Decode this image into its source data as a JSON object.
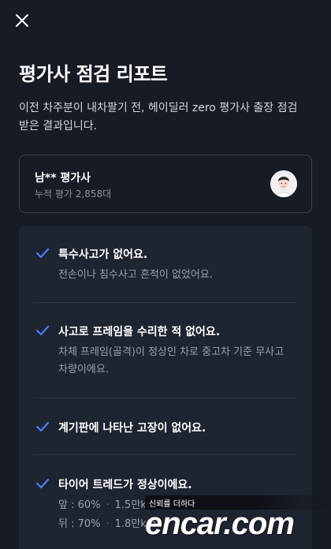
{
  "header": {
    "close_icon": "close-icon",
    "title": "평가사 점검 리포트",
    "description": "이전 차주분이 내차팔기 전, 헤이딜러 zero 평가사 출장 점검받은 결과입니다."
  },
  "evaluator": {
    "name": "남** 평가사",
    "count": "누적 평가 2,858대",
    "avatar_icon": "avatar"
  },
  "checklist": [
    {
      "title": "특수사고가 없어요.",
      "sub": "전손이나 침수사고 흔적이 없었어요."
    },
    {
      "title": "사고로 프레임을 수리한 적 없어요.",
      "sub": "차체 프레임(골격)이 정상인 차로 중고차 기준 무사고 차량이에요."
    },
    {
      "title": "계기판에 나타난 고장이 없어요."
    },
    {
      "title": "타이어 트레드가 정상이에요.",
      "front": {
        "label": "앞 : 60%",
        "dist": "1.5만km"
      },
      "rear": {
        "label": "뒤 : 70%",
        "dist": "1.8만km"
      }
    }
  ],
  "watermark": {
    "tagline": "신뢰를 더하다",
    "logo": "encar.com"
  },
  "colors": {
    "background": "#161b24",
    "card": "#1e2430",
    "check": "#4c7dff",
    "muted": "#9aa1ad"
  }
}
